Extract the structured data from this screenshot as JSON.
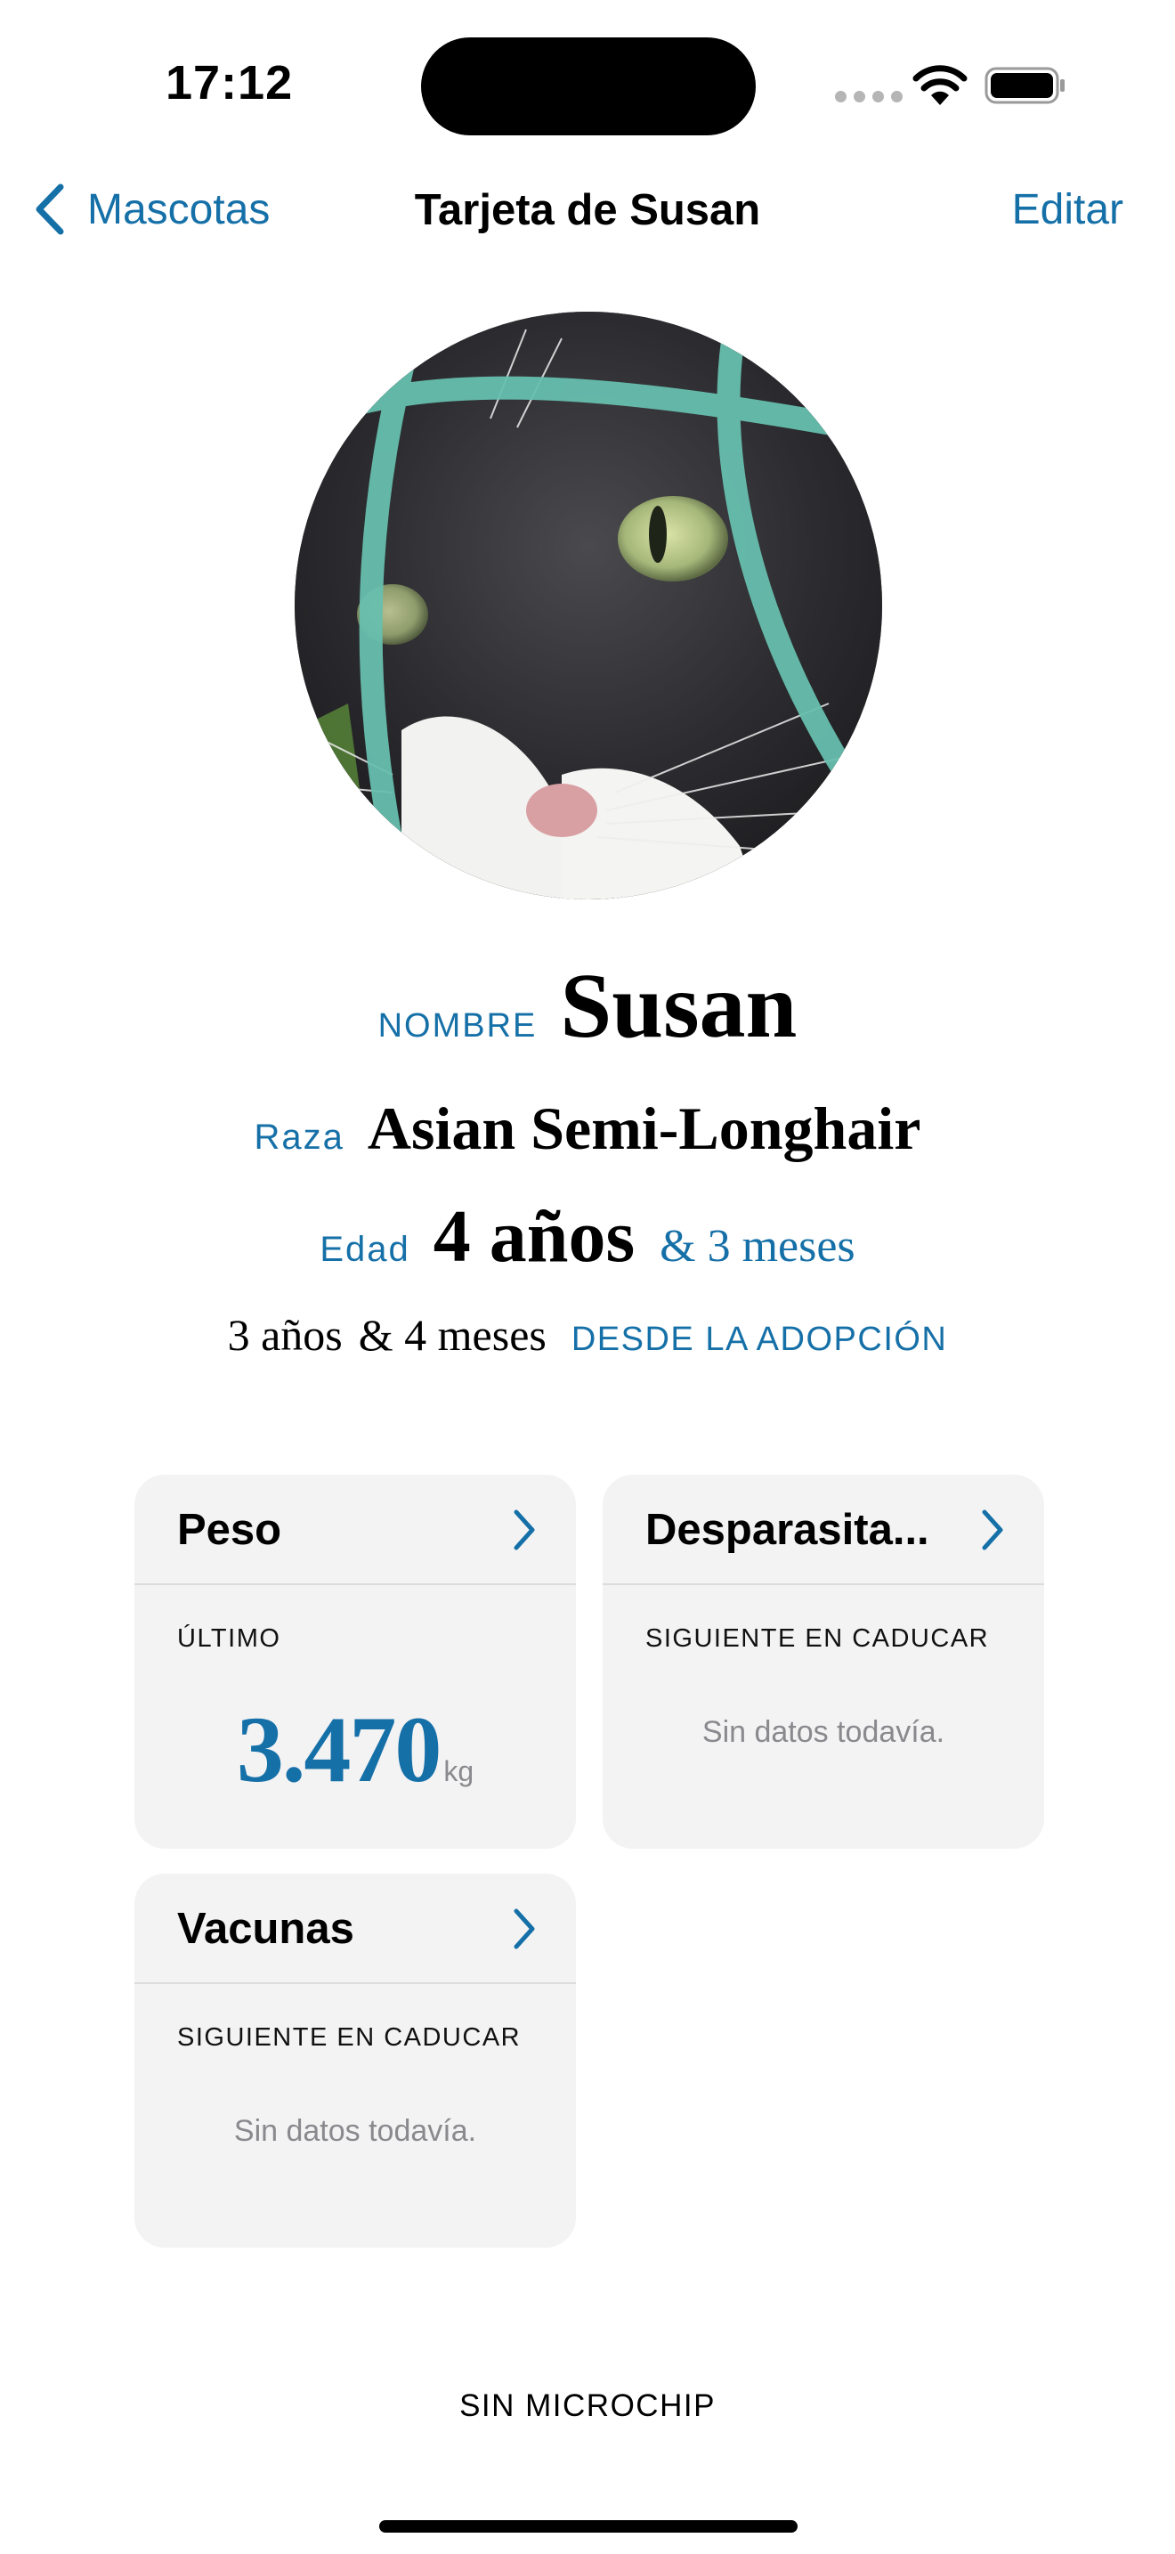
{
  "status_bar": {
    "time": "17:12",
    "icons": [
      "signal-dots-icon",
      "wifi-icon",
      "battery-icon"
    ]
  },
  "nav": {
    "back_label": "Mascotas",
    "title": "Tarjeta de Susan",
    "edit_label": "Editar"
  },
  "pet": {
    "name_label": "NOMBRE",
    "name": "Susan",
    "breed_label": "Raza",
    "breed": "Asian Semi-Longhair",
    "age_label": "Edad",
    "age": "4 años",
    "age_extra": "& 3 meses",
    "adoption_years": "3 años",
    "adoption_months": "& 4 meses",
    "adoption_label": "DESDE LA ADOPCIÓN"
  },
  "cards": {
    "weight": {
      "title": "Peso",
      "subtitle": "ÚLTIMO",
      "value": "3.470",
      "unit": "kg"
    },
    "deworming": {
      "title": "Desparasita...",
      "subtitle": "SIGUIENTE EN CADUCAR",
      "empty": "Sin datos todavía."
    },
    "vaccines": {
      "title": "Vacunas",
      "subtitle": "SIGUIENTE EN CADUCAR",
      "empty": "Sin datos todavía."
    }
  },
  "microchip": "SIN MICROCHIP",
  "colors": {
    "accent": "#1670a8",
    "card_bg": "#f3f3f4",
    "muted": "#8a8a8e"
  }
}
